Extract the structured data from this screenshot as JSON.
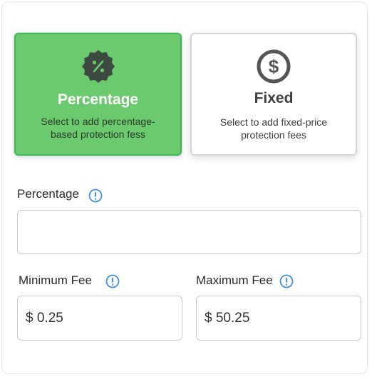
{
  "fee_type_options": [
    {
      "title": "Percentage",
      "description": "Select to add percentage-based protection fess",
      "icon": "percent-badge-icon",
      "selected": true
    },
    {
      "title": "Fixed",
      "description": "Select to add fixed-price protection fees",
      "icon": "dollar-circle-icon",
      "selected": false
    }
  ],
  "percentage_field": {
    "label": "Percentage",
    "value": "",
    "info_icon": "info-icon"
  },
  "minimum_fee_field": {
    "label": "Minimum Fee",
    "value": "$ 0.25",
    "info_icon": "info-icon"
  },
  "maximum_fee_field": {
    "label": "Maximum Fee",
    "value": "$ 50.25",
    "info_icon": "info-icon"
  },
  "colors": {
    "selected_card": "#6bca6d",
    "selected_border": "#43b859",
    "info_blue": "#3d8ff0"
  }
}
